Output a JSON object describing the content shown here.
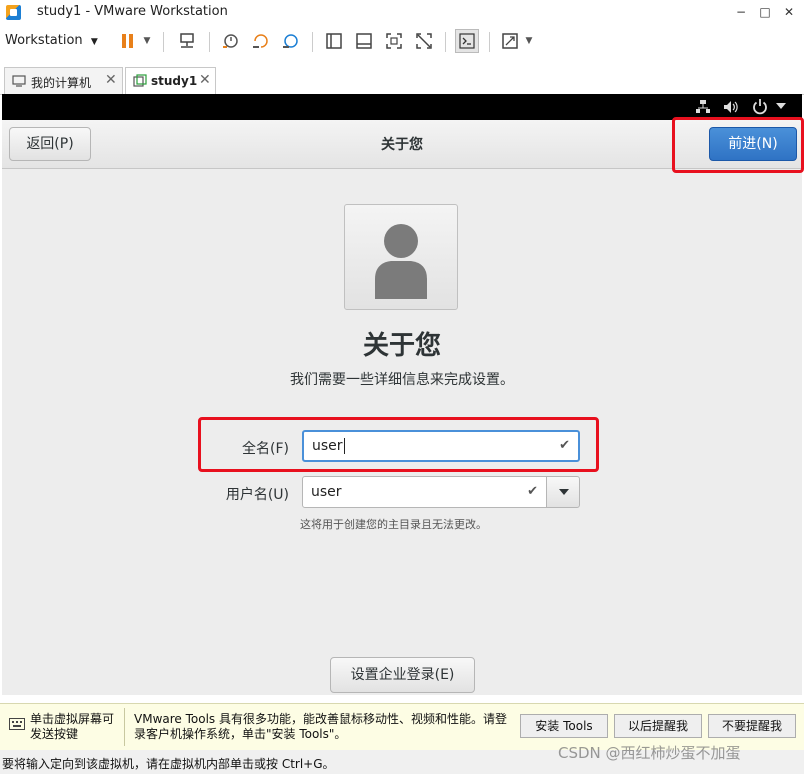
{
  "window": {
    "title": "study1 - VMware Workstation",
    "minimize": "−",
    "maximize": "□",
    "close": "✕"
  },
  "toolbar": {
    "menu_label": "Workstation"
  },
  "tabs": [
    {
      "label": "我的计算机",
      "close": "✕"
    },
    {
      "label": "study1",
      "close": "✕"
    }
  ],
  "installer": {
    "back_button": "返回(P)",
    "header_title": "关于您",
    "next_button": "前进(N)",
    "heading": "关于您",
    "subtitle": "我们需要一些详细信息来完成设置。",
    "fullname_label": "全名(F)",
    "fullname_value": "user",
    "username_label": "用户名(U)",
    "username_value": "user",
    "hint": "这将用于创建您的主目录且无法更改。",
    "enterprise_button": "设置企业登录(E)"
  },
  "notification": {
    "left_text": "单击虚拟屏幕可发送按键",
    "message": "VMware Tools 具有很多功能，能改善鼠标移动性、视频和性能。请登录客户机操作系统，单击\"安装 Tools\"。",
    "install_button": "安装 Tools",
    "remind_later_button": "以后提醒我",
    "never_remind_button": "不要提醒我"
  },
  "statusbar": {
    "text": "要将输入定向到该虚拟机，请在虚拟机内部单击或按 Ctrl+G。"
  },
  "watermark": "CSDN @西红柿炒蛋不加蛋",
  "colors": {
    "accent": "#3a84d4",
    "highlight": "#e8101e"
  }
}
